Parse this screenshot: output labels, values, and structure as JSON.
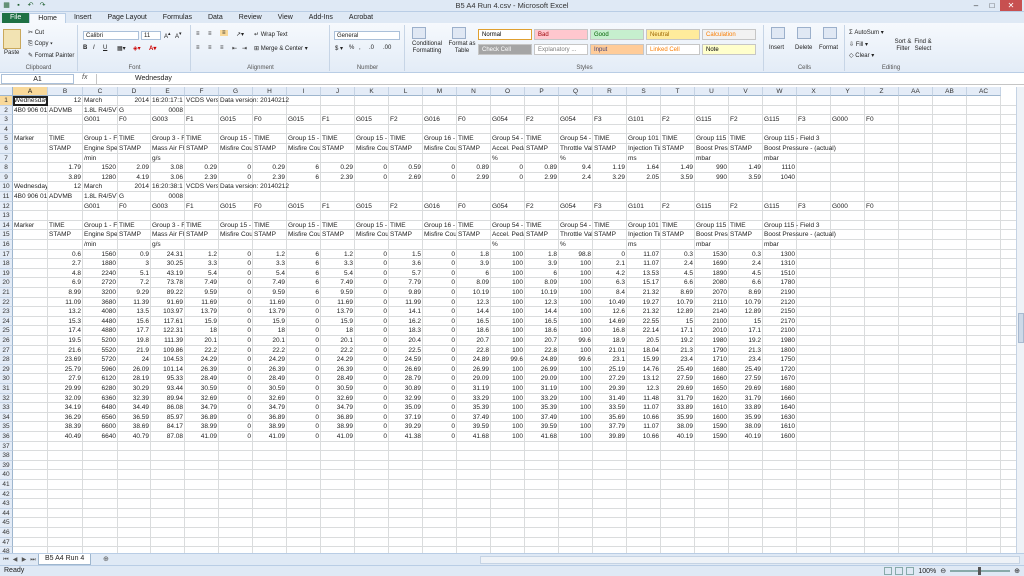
{
  "window": {
    "title": "B5 A4 Run 4.csv - Microsoft Excel"
  },
  "ribbon_tabs": [
    "File",
    "Home",
    "Insert",
    "Page Layout",
    "Formulas",
    "Data",
    "Review",
    "View",
    "Add-Ins",
    "Acrobat"
  ],
  "ribbon": {
    "clipboard": {
      "paste": "Paste",
      "cut": "Cut",
      "copy": "Copy",
      "format_painter": "Format Painter",
      "label": "Clipboard"
    },
    "font": {
      "name": "Calibri",
      "size": "11",
      "label": "Font"
    },
    "alignment": {
      "wrap": "Wrap Text",
      "merge": "Merge & Center",
      "label": "Alignment"
    },
    "number": {
      "format": "General",
      "label": "Number"
    },
    "styles": {
      "conditional": "Conditional Formatting",
      "format_table": "Format as Table",
      "label": "Styles",
      "cells": [
        {
          "label": "Normal",
          "bg": "#ffffff",
          "fg": "#000000"
        },
        {
          "label": "Bad",
          "bg": "#ffc7ce",
          "fg": "#9c0006"
        },
        {
          "label": "Good",
          "bg": "#c6efce",
          "fg": "#006100"
        },
        {
          "label": "Neutral",
          "bg": "#ffeb9c",
          "fg": "#9c6500"
        },
        {
          "label": "Calculation",
          "bg": "#f2f2f2",
          "fg": "#fa7d00"
        },
        {
          "label": "Check Cell",
          "bg": "#a5a5a5",
          "fg": "#ffffff"
        },
        {
          "label": "Explanatory ...",
          "bg": "#ffffff",
          "fg": "#7f7f7f"
        },
        {
          "label": "Input",
          "bg": "#ffcc99",
          "fg": "#3f3f76"
        },
        {
          "label": "Linked Cell",
          "bg": "#ffffff",
          "fg": "#fa7d00"
        },
        {
          "label": "Note",
          "bg": "#ffffcc",
          "fg": "#000000"
        }
      ]
    },
    "cells_group": {
      "insert": "Insert",
      "delete": "Delete",
      "format": "Format",
      "label": "Cells"
    },
    "editing": {
      "autosum": "AutoSum",
      "fill": "Fill",
      "clear": "Clear",
      "sort": "Sort & Filter",
      "find": "Find & Select",
      "label": "Editing"
    }
  },
  "formula_bar": {
    "name_box": "A1",
    "fx": "fx",
    "content": "Wednesday"
  },
  "columns": [
    "A",
    "B",
    "C",
    "D",
    "E",
    "F",
    "G",
    "H",
    "I",
    "J",
    "K",
    "L",
    "M",
    "N",
    "O",
    "P",
    "Q",
    "R",
    "S",
    "T",
    "U",
    "V",
    "W",
    "X",
    "Y",
    "Z",
    "AA",
    "AB",
    "AC"
  ],
  "row_numbers": [
    "1",
    "2",
    "3",
    "4",
    "5",
    "6",
    "7",
    "8",
    "9",
    "10",
    "11",
    "12",
    "13",
    "14",
    "15",
    "16",
    "17",
    "18",
    "19",
    "20",
    "21",
    "22",
    "23",
    "24",
    "25",
    "26",
    "27",
    "28",
    "29",
    "30",
    "31",
    "32",
    "33",
    "34",
    "35",
    "36",
    "37",
    "38",
    "39",
    "40",
    "41",
    "42",
    "43",
    "44",
    "45",
    "46",
    "47",
    "48"
  ],
  "rows": [
    [
      "Wednesday",
      "12",
      "March",
      "2014",
      "16:20:17:1",
      "VCDS Version",
      "Data version: 20140212"
    ],
    [
      "4B0 906 018",
      "ADVMB",
      "1.8L R4/5VT",
      "G",
      "0008"
    ],
    [
      "",
      "",
      "G001",
      "F0",
      "G003",
      "F1",
      "G015",
      "F0",
      "G015",
      "F1",
      "G015",
      "F2",
      "G016",
      "F0",
      "G054",
      "F2",
      "G054",
      "F3",
      "G101",
      "F2",
      "G115",
      "F2",
      "G115",
      "F3",
      "G000",
      "F0"
    ],
    [],
    [
      "Marker",
      "TIME",
      "Group 1 - Field",
      "TIME",
      "Group 3 - Field",
      "TIME",
      "Group 15 - Field",
      "TIME",
      "Group 15 - Field",
      "TIME",
      "Group 15 - Field",
      "TIME",
      "Group 16 - Field",
      "TIME",
      "Group 54 - Field",
      "TIME",
      "Group 54 - Field",
      "TIME",
      "Group 101 - Field",
      "TIME",
      "Group 115 - Field",
      "TIME",
      "Group 115 - Field 3"
    ],
    [
      "",
      "STAMP",
      "Engine Speed",
      "STAMP",
      "Mass Air Flow",
      "STAMP",
      "Misfire Counter",
      "STAMP",
      "Misfire Counter",
      "STAMP",
      "Misfire Counter",
      "STAMP",
      "Misfire Counter",
      "STAMP",
      "Accel. Pedal",
      "STAMP",
      "Throttle Valve",
      "STAMP",
      "Injection Time",
      "STAMP",
      "Boost Pressure",
      "STAMP",
      "Boost Pressure - (actual)"
    ],
    [
      "",
      "",
      "/min",
      "",
      "g/s",
      "",
      "",
      "",
      "",
      "",
      "",
      "",
      "",
      "",
      "%",
      "",
      "%",
      "",
      "ms",
      "",
      "mbar",
      "",
      "mbar"
    ],
    [
      "",
      "1.79",
      "1520",
      "2.09",
      "3.08",
      "0.29",
      "0",
      "0.29",
      "6",
      "0.29",
      "0",
      "0.59",
      "0",
      "0.89",
      "0",
      "0.89",
      "9.4",
      "1.19",
      "1.64",
      "1.49",
      "990",
      "1.49",
      "1110"
    ],
    [
      "",
      "3.89",
      "1280",
      "4.19",
      "3.06",
      "2.39",
      "0",
      "2.39",
      "6",
      "2.39",
      "0",
      "2.69",
      "0",
      "2.99",
      "0",
      "2.99",
      "2.4",
      "3.29",
      "2.05",
      "3.59",
      "990",
      "3.59",
      "1040"
    ],
    [
      "Wednesday",
      "12",
      "March",
      "2014",
      "16:20:38:1",
      "VCDS Version",
      "Data version: 20140212"
    ],
    [
      "4B0 906 018",
      "ADVMB",
      "1.8L R4/5VT",
      "G",
      "0008"
    ],
    [
      "",
      "",
      "G001",
      "F0",
      "G003",
      "F1",
      "G015",
      "F0",
      "G015",
      "F1",
      "G015",
      "F2",
      "G016",
      "F0",
      "G054",
      "F2",
      "G054",
      "F3",
      "G101",
      "F2",
      "G115",
      "F2",
      "G115",
      "F3",
      "G000",
      "F0"
    ],
    [],
    [
      "Marker",
      "TIME",
      "Group 1 - Field",
      "TIME",
      "Group 3 - Field",
      "TIME",
      "Group 15 - Field",
      "TIME",
      "Group 15 - Field",
      "TIME",
      "Group 15 - Field",
      "TIME",
      "Group 16 - Field",
      "TIME",
      "Group 54 - Field",
      "TIME",
      "Group 54 - Field",
      "TIME",
      "Group 101 - Field",
      "TIME",
      "Group 115 - Field",
      "TIME",
      "Group 115 - Field 3"
    ],
    [
      "",
      "STAMP",
      "Engine Speed",
      "STAMP",
      "Mass Air Flow",
      "STAMP",
      "Misfire Counter",
      "STAMP",
      "Misfire Counter",
      "STAMP",
      "Misfire Counter",
      "STAMP",
      "Misfire Counter",
      "STAMP",
      "Accel. Pedal",
      "STAMP",
      "Throttle Valve",
      "STAMP",
      "Injection Time",
      "STAMP",
      "Boost Pressure",
      "STAMP",
      "Boost Pressure - (actual)"
    ],
    [
      "",
      "",
      "/min",
      "",
      "g/s",
      "",
      "",
      "",
      "",
      "",
      "",
      "",
      "",
      "",
      "%",
      "",
      "%",
      "",
      "ms",
      "",
      "mbar",
      "",
      "mbar"
    ],
    [
      "",
      "0.6",
      "1560",
      "0.9",
      "24.31",
      "1.2",
      "0",
      "1.2",
      "6",
      "1.2",
      "0",
      "1.5",
      "0",
      "1.8",
      "100",
      "1.8",
      "98.8",
      "0",
      "11.07",
      "0.3",
      "1530",
      "0.3",
      "1300"
    ],
    [
      "",
      "2.7",
      "1880",
      "3",
      "30.25",
      "3.3",
      "0",
      "3.3",
      "6",
      "3.3",
      "0",
      "3.6",
      "0",
      "3.9",
      "100",
      "3.9",
      "100",
      "2.1",
      "11.07",
      "2.4",
      "1690",
      "2.4",
      "1310"
    ],
    [
      "",
      "4.8",
      "2240",
      "5.1",
      "43.19",
      "5.4",
      "0",
      "5.4",
      "6",
      "5.4",
      "0",
      "5.7",
      "0",
      "6",
      "100",
      "6",
      "100",
      "4.2",
      "13.53",
      "4.5",
      "1890",
      "4.5",
      "1510"
    ],
    [
      "",
      "6.9",
      "2720",
      "7.2",
      "73.78",
      "7.49",
      "0",
      "7.49",
      "6",
      "7.49",
      "0",
      "7.79",
      "0",
      "8.09",
      "100",
      "8.09",
      "100",
      "6.3",
      "15.17",
      "6.6",
      "2080",
      "6.6",
      "1780"
    ],
    [
      "",
      "8.99",
      "3200",
      "9.29",
      "89.22",
      "9.59",
      "0",
      "9.59",
      "6",
      "9.59",
      "0",
      "9.89",
      "0",
      "10.19",
      "100",
      "10.19",
      "100",
      "8.4",
      "21.32",
      "8.69",
      "2070",
      "8.69",
      "2190"
    ],
    [
      "",
      "11.09",
      "3680",
      "11.39",
      "91.69",
      "11.69",
      "0",
      "11.69",
      "0",
      "11.69",
      "0",
      "11.99",
      "0",
      "12.3",
      "100",
      "12.3",
      "100",
      "10.49",
      "19.27",
      "10.79",
      "2110",
      "10.79",
      "2120"
    ],
    [
      "",
      "13.2",
      "4080",
      "13.5",
      "103.97",
      "13.79",
      "0",
      "13.79",
      "0",
      "13.79",
      "0",
      "14.1",
      "0",
      "14.4",
      "100",
      "14.4",
      "100",
      "12.6",
      "21.32",
      "12.89",
      "2140",
      "12.89",
      "2150"
    ],
    [
      "",
      "15.3",
      "4480",
      "15.6",
      "117.61",
      "15.9",
      "0",
      "15.9",
      "0",
      "15.9",
      "0",
      "16.2",
      "0",
      "16.5",
      "100",
      "16.5",
      "100",
      "14.69",
      "22.55",
      "15",
      "2100",
      "15",
      "2170"
    ],
    [
      "",
      "17.4",
      "4880",
      "17.7",
      "122.31",
      "18",
      "0",
      "18",
      "0",
      "18",
      "0",
      "18.3",
      "0",
      "18.6",
      "100",
      "18.6",
      "100",
      "16.8",
      "22.14",
      "17.1",
      "2010",
      "17.1",
      "2100"
    ],
    [
      "",
      "19.5",
      "5200",
      "19.8",
      "111.39",
      "20.1",
      "0",
      "20.1",
      "0",
      "20.1",
      "0",
      "20.4",
      "0",
      "20.7",
      "100",
      "20.7",
      "99.6",
      "18.9",
      "20.5",
      "19.2",
      "1980",
      "19.2",
      "1980"
    ],
    [
      "",
      "21.6",
      "5520",
      "21.9",
      "109.86",
      "22.2",
      "0",
      "22.2",
      "0",
      "22.2",
      "0",
      "22.5",
      "0",
      "22.8",
      "100",
      "22.8",
      "100",
      "21.01",
      "18.04",
      "21.3",
      "1790",
      "21.3",
      "1800"
    ],
    [
      "",
      "23.69",
      "5720",
      "24",
      "104.53",
      "24.29",
      "0",
      "24.29",
      "0",
      "24.29",
      "0",
      "24.59",
      "0",
      "24.89",
      "99.6",
      "24.89",
      "99.6",
      "23.1",
      "15.99",
      "23.4",
      "1710",
      "23.4",
      "1750"
    ],
    [
      "",
      "25.79",
      "5960",
      "26.09",
      "101.14",
      "26.39",
      "0",
      "26.39",
      "0",
      "26.39",
      "0",
      "26.69",
      "0",
      "26.99",
      "100",
      "26.99",
      "100",
      "25.19",
      "14.76",
      "25.49",
      "1680",
      "25.49",
      "1720"
    ],
    [
      "",
      "27.9",
      "6120",
      "28.19",
      "95.33",
      "28.49",
      "0",
      "28.49",
      "0",
      "28.49",
      "0",
      "28.79",
      "0",
      "29.09",
      "100",
      "29.09",
      "100",
      "27.29",
      "13.12",
      "27.59",
      "1660",
      "27.59",
      "1670"
    ],
    [
      "",
      "29.99",
      "6280",
      "30.29",
      "93.44",
      "30.59",
      "0",
      "30.59",
      "0",
      "30.59",
      "0",
      "30.89",
      "0",
      "31.19",
      "100",
      "31.19",
      "100",
      "29.39",
      "12.3",
      "29.69",
      "1650",
      "29.69",
      "1680"
    ],
    [
      "",
      "32.09",
      "6360",
      "32.39",
      "89.94",
      "32.69",
      "0",
      "32.69",
      "0",
      "32.69",
      "0",
      "32.99",
      "0",
      "33.29",
      "100",
      "33.29",
      "100",
      "31.49",
      "11.48",
      "31.79",
      "1620",
      "31.79",
      "1660"
    ],
    [
      "",
      "34.19",
      "6480",
      "34.49",
      "86.08",
      "34.79",
      "0",
      "34.79",
      "0",
      "34.79",
      "0",
      "35.09",
      "0",
      "35.39",
      "100",
      "35.39",
      "100",
      "33.59",
      "11.07",
      "33.89",
      "1610",
      "33.89",
      "1640"
    ],
    [
      "",
      "36.29",
      "6560",
      "36.59",
      "85.97",
      "36.89",
      "0",
      "36.89",
      "0",
      "36.89",
      "0",
      "37.19",
      "0",
      "37.49",
      "100",
      "37.49",
      "100",
      "35.69",
      "10.66",
      "35.99",
      "1600",
      "35.99",
      "1630"
    ],
    [
      "",
      "38.39",
      "6600",
      "38.69",
      "84.17",
      "38.99",
      "0",
      "38.99",
      "0",
      "38.99",
      "0",
      "39.29",
      "0",
      "39.59",
      "100",
      "39.59",
      "100",
      "37.79",
      "11.07",
      "38.09",
      "1590",
      "38.09",
      "1610"
    ],
    [
      "",
      "40.49",
      "6640",
      "40.79",
      "87.08",
      "41.09",
      "0",
      "41.09",
      "0",
      "41.09",
      "0",
      "41.38",
      "0",
      "41.68",
      "100",
      "41.68",
      "100",
      "39.89",
      "10.66",
      "40.19",
      "1590",
      "40.19",
      "1600"
    ]
  ],
  "sheet_tab": "B5 A4 Run 4",
  "status": {
    "ready": "Ready",
    "zoom": "100%"
  }
}
